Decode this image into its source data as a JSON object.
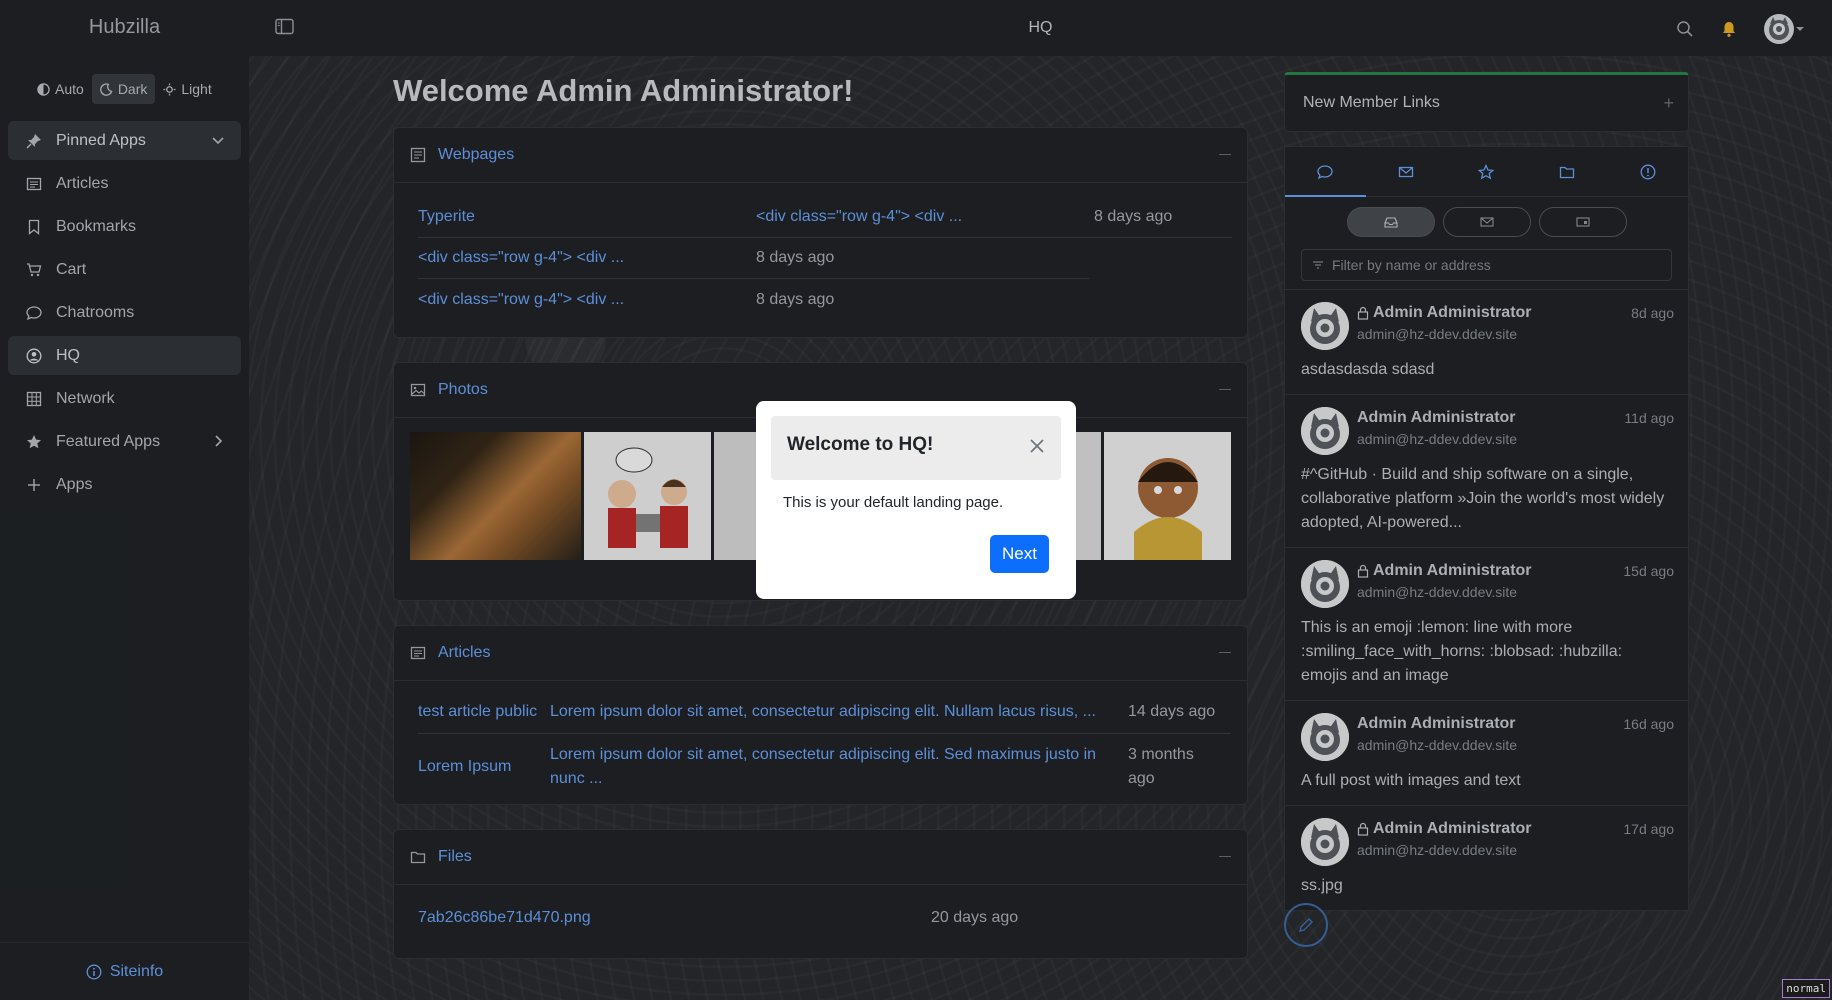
{
  "app": {
    "brand": "Hubzilla",
    "page_title": "HQ"
  },
  "theme": {
    "auto": "Auto",
    "dark": "Dark",
    "light": "Light",
    "selected": "Dark"
  },
  "sidebar": {
    "items": [
      {
        "label": "Pinned Apps",
        "icon": "pin-icon"
      },
      {
        "label": "Articles",
        "icon": "newspaper-icon"
      },
      {
        "label": "Bookmarks",
        "icon": "bookmark-icon"
      },
      {
        "label": "Cart",
        "icon": "cart-icon"
      },
      {
        "label": "Chatrooms",
        "icon": "chat-icon"
      },
      {
        "label": "HQ",
        "icon": "person-circle-icon"
      },
      {
        "label": "Network",
        "icon": "grid-icon"
      },
      {
        "label": "Featured Apps",
        "icon": "star-icon"
      },
      {
        "label": "Apps",
        "icon": "plus-icon"
      }
    ],
    "siteinfo": "Siteinfo"
  },
  "main": {
    "welcome": "Welcome Admin Administrator!",
    "webpages": {
      "title": "Webpages",
      "rows": [
        {
          "name": "Typerite",
          "link2": "<div class=\"row g-4\"> <div ...",
          "date": "8 days ago"
        },
        {
          "name": "<div class=\"row g-4\"> <div ...",
          "date": "8 days ago"
        },
        {
          "name": "<div class=\"row g-4\"> <div ...",
          "date": "8 days ago"
        }
      ]
    },
    "photos": {
      "title": "Photos"
    },
    "articles": {
      "title": "Articles",
      "rows": [
        {
          "title": "test article public",
          "summary": "Lorem ipsum dolor sit amet, consectetur adipiscing elit. Nullam lacus risus, ...",
          "date": "14 days ago"
        },
        {
          "title": "Lorem Ipsum",
          "summary": "Lorem ipsum dolor sit amet, consectetur adipiscing elit. Sed maximus justo in nunc ...",
          "date": "3 months ago"
        }
      ]
    },
    "files": {
      "title": "Files",
      "rows": [
        {
          "name": "7ab26c86be71d470.png",
          "date": "20 days ago"
        }
      ]
    }
  },
  "right": {
    "new_member_links": "New Member Links",
    "filter_placeholder": "Filter by name or address",
    "stream": [
      {
        "author": "Admin Administrator",
        "address": "admin@hz-ddev.ddev.site",
        "ago": "8d ago",
        "locked": true,
        "text": "asdasdasda sdasd"
      },
      {
        "author": "Admin Administrator",
        "address": "admin@hz-ddev.ddev.site",
        "ago": "11d ago",
        "locked": false,
        "text": "#^GitHub · Build and ship software on a single, collaborative platform »Join the world's most widely adopted, AI-powered..."
      },
      {
        "author": "Admin Administrator",
        "address": "admin@hz-ddev.ddev.site",
        "ago": "15d ago",
        "locked": true,
        "text": "This is an emoji :lemon: line with more :smiling_face_with_horns: :blobsad: :hubzilla: emojis and an image"
      },
      {
        "author": "Admin Administrator",
        "address": "admin@hz-ddev.ddev.site",
        "ago": "16d ago",
        "locked": false,
        "text": "A full post with images and text"
      },
      {
        "author": "Admin Administrator",
        "address": "admin@hz-ddev.ddev.site",
        "ago": "17d ago",
        "locked": true,
        "text": "ss.jpg"
      }
    ]
  },
  "modal": {
    "title": "Welcome to HQ!",
    "body": "This is your default landing page.",
    "next": "Next"
  },
  "status_tag": "normal",
  "colors": {
    "accent": "#6ea8fe",
    "primary_button": "#0d6efd",
    "nml_border": "#2c8a4e"
  }
}
